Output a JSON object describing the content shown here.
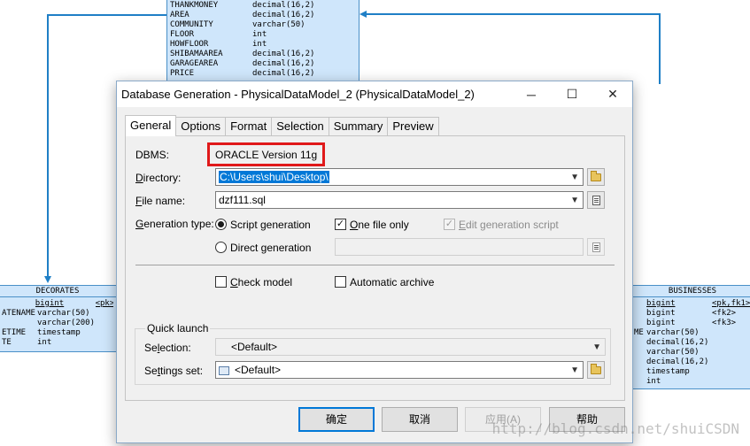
{
  "background": {
    "top_entity": {
      "rows": [
        [
          "THANKMONEY",
          "decimal(16,2)"
        ],
        [
          "AREA",
          "decimal(16,2)"
        ],
        [
          "COMMUNITY",
          "varchar(50)"
        ],
        [
          "FLOOR",
          "int"
        ],
        [
          "HOWFLOOR",
          "int"
        ],
        [
          "SHIBAMAAREA",
          "decimal(16,2)"
        ],
        [
          "GARAGEAREA",
          "decimal(16,2)"
        ],
        [
          "PRICE",
          "decimal(16,2)"
        ]
      ]
    },
    "left_entity": {
      "title": "DECORATES",
      "rows": [
        [
          "",
          "bigint",
          "<pk>"
        ],
        [
          "ATENAME",
          "varchar(50)",
          ""
        ],
        [
          "",
          "varchar(200)",
          ""
        ],
        [
          "ETIME",
          "timestamp",
          ""
        ],
        [
          "TE",
          "int",
          ""
        ]
      ]
    },
    "right_entity": {
      "title": "BUSINESSES",
      "rows": [
        [
          "",
          "bigint",
          "<pk,fk1>"
        ],
        [
          "",
          "bigint",
          "<fk2>"
        ],
        [
          "",
          "bigint",
          "<fk3>"
        ],
        [
          "ME",
          "varchar(50)",
          ""
        ],
        [
          "",
          "decimal(16,2)",
          ""
        ],
        [
          "",
          "varchar(50)",
          ""
        ],
        [
          "",
          "decimal(16,2)",
          ""
        ],
        [
          "",
          "timestamp",
          ""
        ],
        [
          "",
          "int",
          ""
        ]
      ]
    },
    "watermark": "http://blog.csdn.net/shuiCSDN"
  },
  "dialog": {
    "title": "Database Generation - PhysicalDataModel_2 (PhysicalDataModel_2)",
    "window_buttons": {
      "minimize": "─",
      "maximize": "☐",
      "close": "✕"
    },
    "tabs": [
      "General",
      "Options",
      "Format",
      "Selection",
      "Summary",
      "Preview"
    ],
    "dbms": {
      "label": "DBMS:",
      "value": "ORACLE Version 11g"
    },
    "directory": {
      "label_underlined": "D",
      "label_rest": "irectory:",
      "value": "C:\\Users\\shui\\Desktop\\"
    },
    "file_name": {
      "label_underlined": "F",
      "label_rest": "ile name:",
      "value": "dzf111.sql"
    },
    "generation_type": {
      "label_pre": "",
      "label_underlined": "G",
      "label_rest": "eneration type:",
      "script": "Script generation",
      "direct": "Direct generation",
      "script_selected": true
    },
    "one_file_only": {
      "label_underlined": "O",
      "label_rest": "ne file only",
      "checked": true
    },
    "edit_script": {
      "label_underlined": "E",
      "label_rest": "dit generation script",
      "checked": true
    },
    "check_model": {
      "label_underlined": "C",
      "label_rest": "heck model",
      "checked": false
    },
    "automatic_archive": {
      "label": "Automatic archive",
      "checked": false
    },
    "quick_launch": {
      "title": "Quick launch",
      "selection_label_pre": "Se",
      "selection_label_ul": "l",
      "selection_label_rest": "ection:",
      "selection_value": "<Default>",
      "settings_label_pre": "Se",
      "settings_label_ul": "t",
      "settings_label_rest": "tings set:",
      "settings_value": "<Default>"
    },
    "buttons": {
      "ok": "确定",
      "cancel": "取消",
      "apply": "应用(A)",
      "help": "帮助"
    }
  }
}
